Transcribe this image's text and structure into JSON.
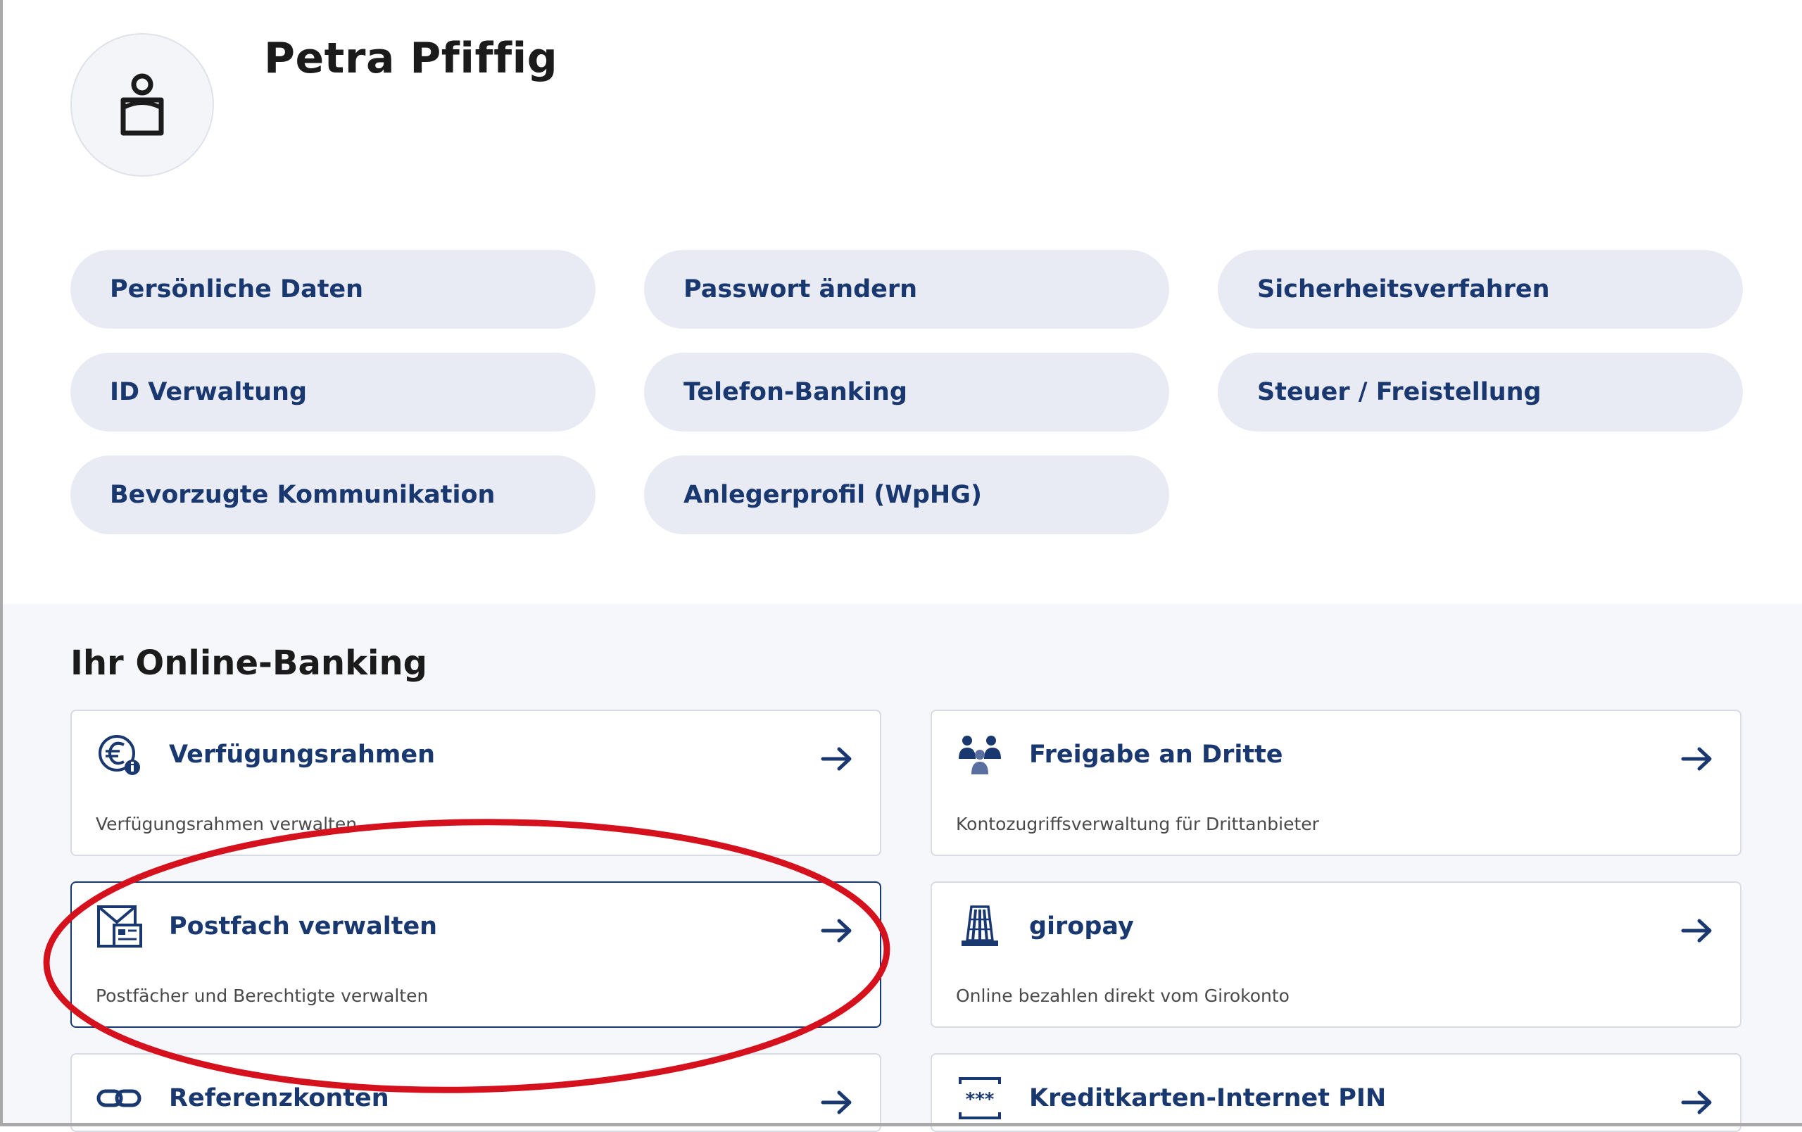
{
  "profile": {
    "name": "Petra Pfiffig",
    "avatar_icon": "user-icon"
  },
  "settings_pills": [
    {
      "label": "Persönliche Daten"
    },
    {
      "label": "Passwort ändern"
    },
    {
      "label": "Sicherheitsverfahren"
    },
    {
      "label": "ID Verwaltung"
    },
    {
      "label": "Telefon-Banking"
    },
    {
      "label": "Steuer / Freistellung"
    },
    {
      "label": "Bevorzugte Kommunikation"
    },
    {
      "label": "Anlegerprofil (WpHG)"
    }
  ],
  "online_banking": {
    "title": "Ihr Online-Banking",
    "cards": [
      {
        "title": "Verfügungsrahmen",
        "description": "Verfügungsrahmen verwalten",
        "icon": "euro-info-icon"
      },
      {
        "title": "Freigabe an Dritte",
        "description": "Kontozugriffsverwaltung für Drittanbieter",
        "icon": "people-group-icon"
      },
      {
        "title": "Postfach verwalten",
        "description": "Postfächer und Berechtigte verwalten",
        "icon": "mailbox-icon"
      },
      {
        "title": "giropay",
        "description": "Online bezahlen direkt vom Girokonto",
        "icon": "bank-building-icon"
      },
      {
        "title": "Referenzkonten",
        "description": "",
        "icon": "link-icon"
      },
      {
        "title": "Kreditkarten-Internet PIN",
        "description": "",
        "icon": "pin-card-icon"
      }
    ]
  },
  "colors": {
    "brand_blue": "#1a3870",
    "pill_bg": "#e9ebf4",
    "annotation_red": "#d4111c"
  }
}
